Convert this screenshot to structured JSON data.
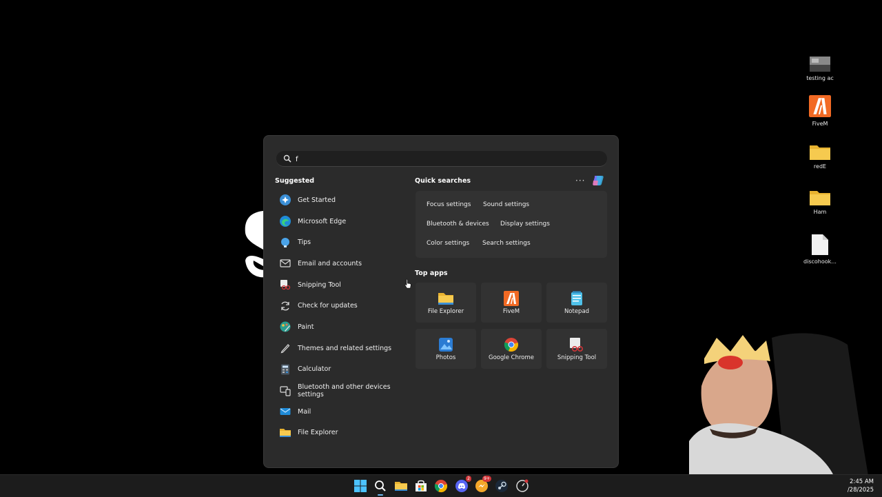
{
  "desktop": {
    "icons": [
      {
        "label": "testing ac",
        "icon": "image-thumbnail-icon"
      },
      {
        "label": "FiveM",
        "icon": "fivem-icon"
      },
      {
        "label": "redE",
        "icon": "folder-icon"
      },
      {
        "label": "Ham",
        "icon": "folder-icon"
      },
      {
        "label": "discohook...",
        "icon": "file-icon"
      }
    ]
  },
  "search": {
    "query": "f",
    "suggested_title": "Suggested",
    "suggested": [
      {
        "label": "Get Started",
        "icon": "get-started-icon"
      },
      {
        "label": "Microsoft Edge",
        "icon": "edge-icon"
      },
      {
        "label": "Tips",
        "icon": "tips-icon"
      },
      {
        "label": "Email and accounts",
        "icon": "email-icon"
      },
      {
        "label": "Snipping Tool",
        "icon": "snipping-tool-icon"
      },
      {
        "label": "Check for updates",
        "icon": "refresh-icon"
      },
      {
        "label": "Paint",
        "icon": "paint-icon"
      },
      {
        "label": "Themes and related settings",
        "icon": "pen-icon"
      },
      {
        "label": "Calculator",
        "icon": "calculator-icon"
      },
      {
        "label": "Bluetooth and other devices settings",
        "icon": "devices-icon"
      },
      {
        "label": "Mail",
        "icon": "mail-icon"
      },
      {
        "label": "File Explorer",
        "icon": "folder-icon"
      }
    ],
    "quick_title": "Quick searches",
    "more_label": "···",
    "quick": [
      "Focus settings",
      "Sound settings",
      "Bluetooth & devices",
      "Display settings",
      "Color settings",
      "Search settings"
    ],
    "top_apps_title": "Top apps",
    "top_apps": [
      {
        "label": "File Explorer",
        "icon": "folder-icon"
      },
      {
        "label": "FiveM",
        "icon": "fivem-icon"
      },
      {
        "label": "Notepad",
        "icon": "notepad-icon"
      },
      {
        "label": "Photos",
        "icon": "photos-icon"
      },
      {
        "label": "Google Chrome",
        "icon": "chrome-icon"
      },
      {
        "label": "Snipping Tool",
        "icon": "snipping-tool-icon"
      }
    ]
  },
  "taskbar": {
    "badges": {
      "discord": "2",
      "messenger": "9+"
    },
    "time": "2:45 AM",
    "date": "/28/2025"
  },
  "colors": {
    "panel": "#2b2b2b",
    "accent": "#6cb8f0",
    "folder": "#f4c342",
    "fivem": "#f26a24"
  }
}
